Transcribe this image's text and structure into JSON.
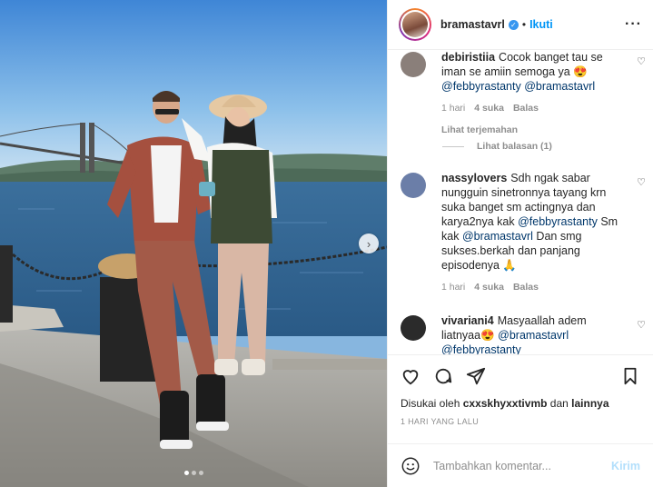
{
  "header": {
    "username": "bramastavrl",
    "separator": "•",
    "follow_label": "Ikuti",
    "more_label": "···"
  },
  "comments": [
    {
      "username": "debiristiia",
      "text": "Cocok banget tau se iman se amiin semoga ya 😍",
      "mentions": "@febbyrastanty @bramastavrl",
      "time": "1 hari",
      "likes": "4 suka",
      "reply": "Balas",
      "translate": "Lihat terjemahan",
      "view_replies": "Lihat balasan (1)",
      "avatar_color": "#8a7f7a"
    },
    {
      "username": "nassylovers",
      "text_1": "Sdh ngak sabar nungguin sinetronnya tayang krn suka banget sm actingnya dan karya2nya kak",
      "mention_1": "@febbyrastanty",
      "text_2": "Sm kak",
      "mention_2": "@bramastavrl",
      "text_3": "Dan smg sukses.berkah dan panjang episodenya 🙏",
      "time": "1 hari",
      "likes": "4 suka",
      "reply": "Balas",
      "avatar_color": "#6b7ea8"
    },
    {
      "username": "vivariani4",
      "text": "Masyaallah adem liatnyaa😍",
      "mention_1": "@bramastavrl",
      "mention_2": "@febbyrastanty",
      "avatar_color": "#2b2b2b"
    }
  ],
  "actions": {
    "liked_by_prefix": "Disukai oleh",
    "liked_by_user": "cxxskhyxxtivmb",
    "liked_by_suffix": "dan",
    "liked_by_others": "lainnya",
    "timestamp": "1 HARI YANG LALU"
  },
  "add_comment": {
    "placeholder": "Tambahkan komentar...",
    "post_label": "Kirim"
  },
  "media": {
    "next_label": "›",
    "slide_count": 3,
    "active_slide": 1
  }
}
